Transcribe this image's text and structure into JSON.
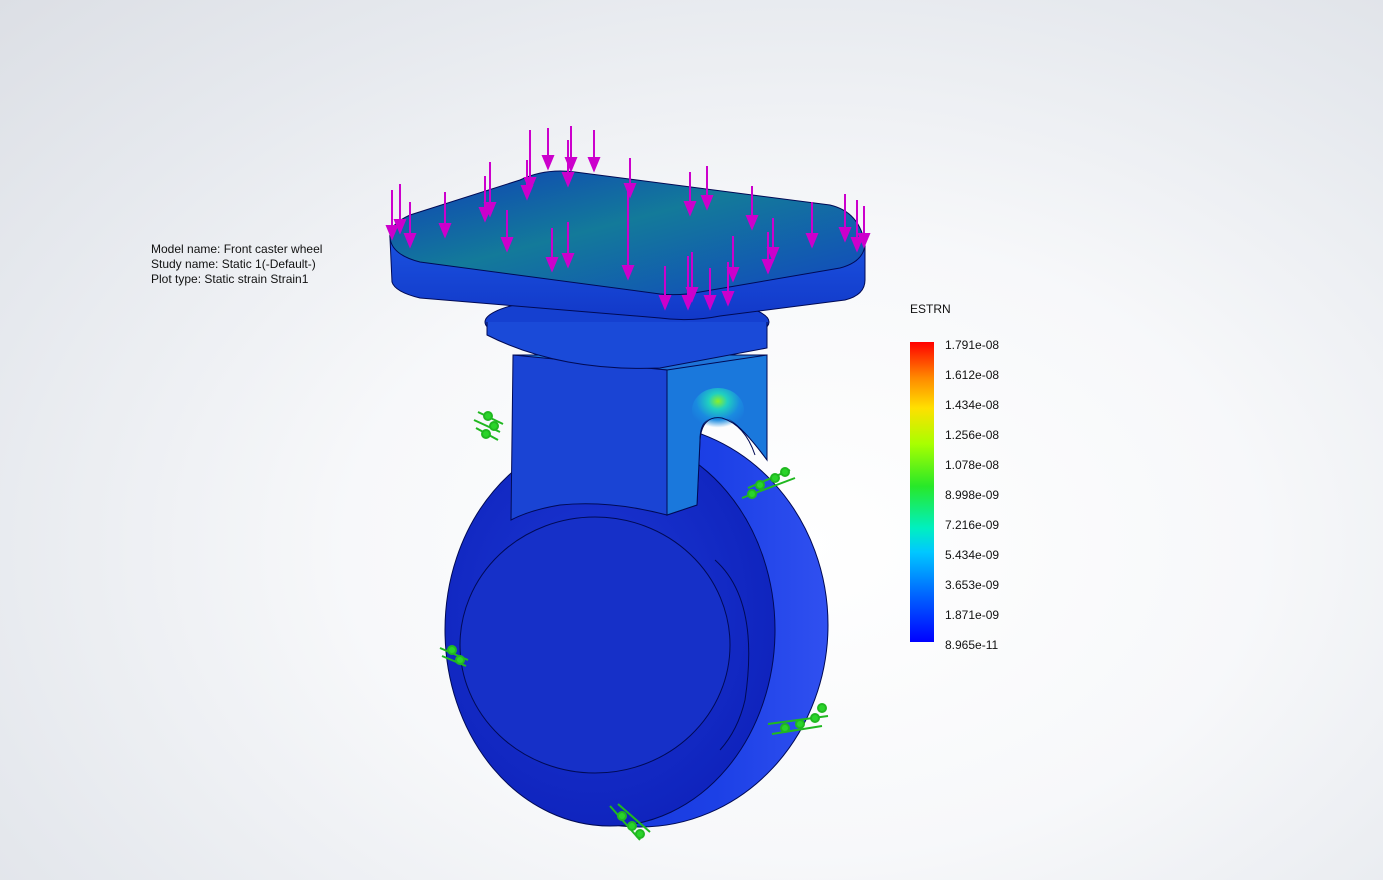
{
  "info": {
    "model_name": "Model name: Front caster wheel",
    "study_name": "Study name: Static 1(-Default-)",
    "plot_type": "Plot type: Static strain Strain1"
  },
  "legend": {
    "title": "ESTRN",
    "ticks": [
      "1.791e-08",
      "1.612e-08",
      "1.434e-08",
      "1.256e-08",
      "1.078e-08",
      "8.998e-09",
      "7.216e-09",
      "5.434e-09",
      "3.653e-09",
      "1.871e-09",
      "8.965e-11"
    ]
  },
  "colors": {
    "load_arrows": "#cc00cc",
    "fixtures": "#22cc22",
    "body": "#1a36d6",
    "max": "#ff0000",
    "min": "#0000ff"
  }
}
